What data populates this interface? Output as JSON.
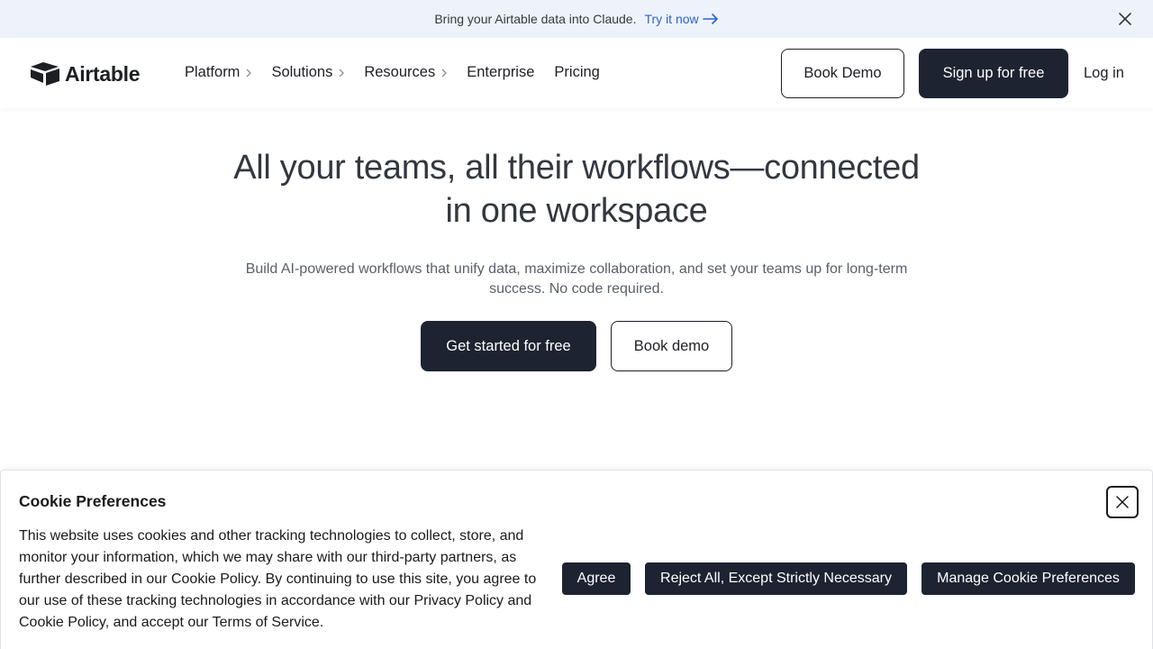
{
  "announcement": {
    "text": "Bring your Airtable data into Claude.",
    "link_label": "Try it now",
    "close_icon": "close-icon"
  },
  "header": {
    "logo_text": "Airtable",
    "nav": [
      {
        "label": "Platform",
        "has_chevron": true
      },
      {
        "label": "Solutions",
        "has_chevron": true
      },
      {
        "label": "Resources",
        "has_chevron": true
      },
      {
        "label": "Enterprise",
        "has_chevron": false
      },
      {
        "label": "Pricing",
        "has_chevron": false
      }
    ],
    "book_demo_label": "Book Demo",
    "signup_label": "Sign up for free",
    "login_label": "Log in"
  },
  "hero": {
    "title_line1": "All your teams, all their workflows—connected",
    "title_line2": "in one workspace",
    "subtitle": "Build AI-powered workflows that unify data, maximize collaboration, and set your teams up for long-term success. No code required.",
    "cta_primary": "Get started for free",
    "cta_secondary": "Book demo"
  },
  "cookie": {
    "title": "Cookie Preferences",
    "body": "This website uses cookies and other tracking technologies to collect, store, and monitor your information, which we may share with our third-party partners, as further described in our Cookie Policy. By continuing to use this site, you agree to our use of these tracking technologies in accordance with our Privacy Policy and Cookie Policy, and accept our Terms of Service.",
    "agree_label": "Agree",
    "reject_label": "Reject All, Except Strictly Necessary",
    "manage_label": "Manage Cookie Preferences"
  },
  "colors": {
    "announcement_bg": "#eef3fb",
    "link": "#2a63c9",
    "dark_button": "#1d2331",
    "text": "#1d1f25"
  }
}
